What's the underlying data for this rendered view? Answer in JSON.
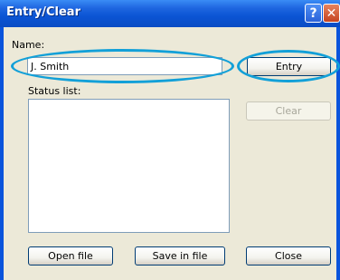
{
  "window": {
    "title": "Entry/Clear",
    "help_glyph": "?",
    "close_glyph": "✕"
  },
  "form": {
    "name_label": "Name:",
    "name_value": "J. Smith",
    "entry_label": "Entry",
    "status_label": "Status list:",
    "clear_label": "Clear",
    "open_file_label": "Open file",
    "save_file_label": "Save in file",
    "close_label": "Close"
  },
  "annotations": {
    "highlight_color": "#12a0d8"
  }
}
